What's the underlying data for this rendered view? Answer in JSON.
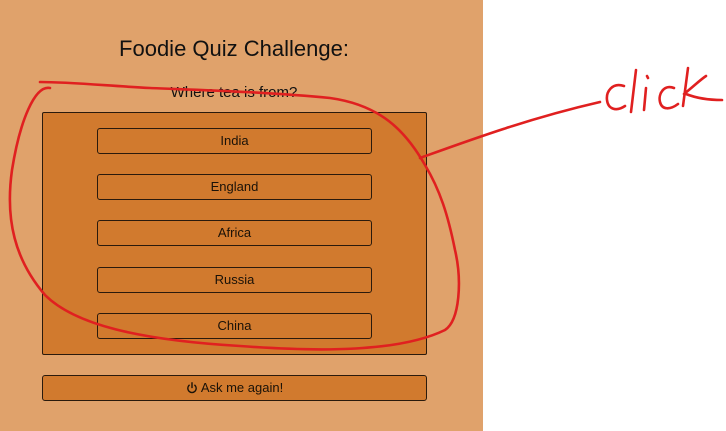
{
  "quiz": {
    "title": "Foodie Quiz Challenge:",
    "question": "Where tea is from?",
    "answers": [
      "India",
      "England",
      "Africa",
      "Russia",
      "China"
    ],
    "restart_label": "Ask me again!",
    "restart_icon": "power-icon"
  },
  "annotation": {
    "handwritten_text": "click",
    "color": "#e02020"
  },
  "colors": {
    "panel_bg": "#e0a26b",
    "button_bg": "#d17a2e",
    "border": "#2a1a0c"
  }
}
